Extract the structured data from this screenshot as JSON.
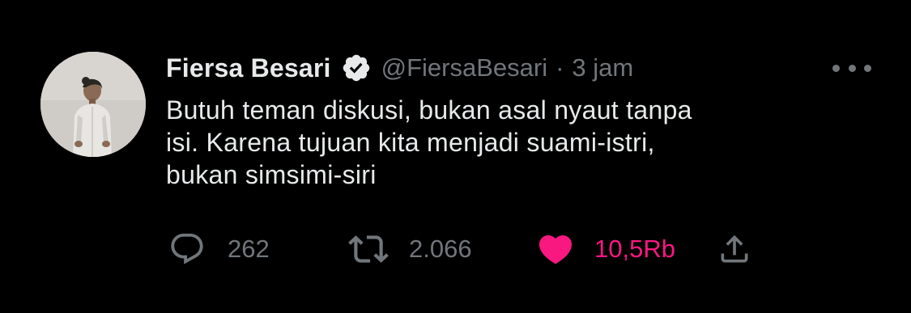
{
  "tweet": {
    "author": {
      "display_name": "Fiersa Besari",
      "handle": "@FiersaBesari",
      "verified": true
    },
    "separator": "·",
    "time": "3 jam",
    "text_lines": [
      "Butuh teman diskusi, bukan asal nyaut tanpa",
      "isi. Karena tujuan kita menjadi suami-istri,",
      "bukan simsimi-siri"
    ],
    "actions": {
      "reply": {
        "icon": "reply-icon",
        "count": "262"
      },
      "retweet": {
        "icon": "retweet-icon",
        "count": "2.066"
      },
      "like": {
        "icon": "heart-icon",
        "count": "10,5Rb",
        "liked": true
      },
      "share": {
        "icon": "share-icon"
      }
    },
    "more_icon": "more-options-icon"
  },
  "colors": {
    "background": "#000000",
    "primary_text": "#e7e9ea",
    "secondary_text": "#71767b",
    "like": "#f91880"
  }
}
